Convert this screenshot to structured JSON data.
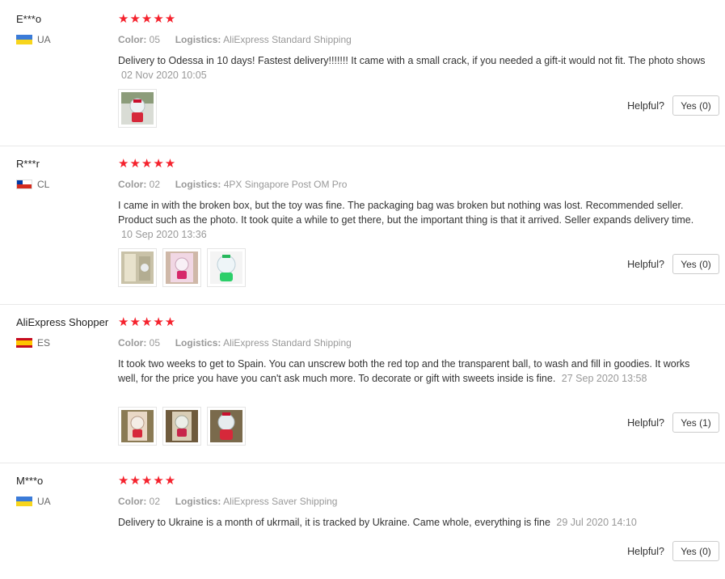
{
  "reviews": [
    {
      "user": "E***o",
      "country": "UA",
      "stars": "★★★★★",
      "color_label": "Color:",
      "color_value": "05",
      "logistics_label": "Logistics:",
      "logistics_value": "AliExpress Standard Shipping",
      "text": "Delivery to Odessa in 10 days! Fastest delivery!!!!!!! It came with a small crack, if you needed a gift-it would not fit. The photo shows",
      "date": "02 Nov 2020 10:05",
      "helpful_label": "Helpful?",
      "helpful_button": "Yes (0)"
    },
    {
      "user": "R***r",
      "country": "CL",
      "stars": "★★★★★",
      "color_label": "Color:",
      "color_value": "02",
      "logistics_label": "Logistics:",
      "logistics_value": "4PX Singapore Post OM Pro",
      "text": "I came in with the broken box, but the toy was fine. The packaging bag was broken but nothing was lost. Recommended seller. Product such as the photo. It took quite a while to get there, but the important thing is that it arrived. Seller expands delivery time.",
      "date": "10 Sep 2020 13:36",
      "helpful_label": "Helpful?",
      "helpful_button": "Yes (0)"
    },
    {
      "user": "AliExpress Shopper",
      "country": "ES",
      "stars": "★★★★★",
      "color_label": "Color:",
      "color_value": "05",
      "logistics_label": "Logistics:",
      "logistics_value": "AliExpress Standard Shipping",
      "text": "It took two weeks to get to Spain. You can unscrew both the red top and the transparent ball, to wash and fill in goodies. It works well, for the price you have you can't ask much more. To decorate or gift with sweets inside is fine.",
      "date": "27 Sep 2020 13:58",
      "helpful_label": "Helpful?",
      "helpful_button": "Yes (1)"
    },
    {
      "user": "M***o",
      "country": "UA",
      "stars": "★★★★★",
      "color_label": "Color:",
      "color_value": "02",
      "logistics_label": "Logistics:",
      "logistics_value": "AliExpress Saver Shipping",
      "text": "Delivery to Ukraine is a month of ukrmail, it is tracked by Ukraine. Came whole, everything is fine",
      "date": "29 Jul 2020 14:10",
      "helpful_label": "Helpful?",
      "helpful_button": "Yes (0)"
    }
  ],
  "colors": {
    "star": "#f5222d",
    "muted": "#999999",
    "divider": "#e8e8e8"
  }
}
